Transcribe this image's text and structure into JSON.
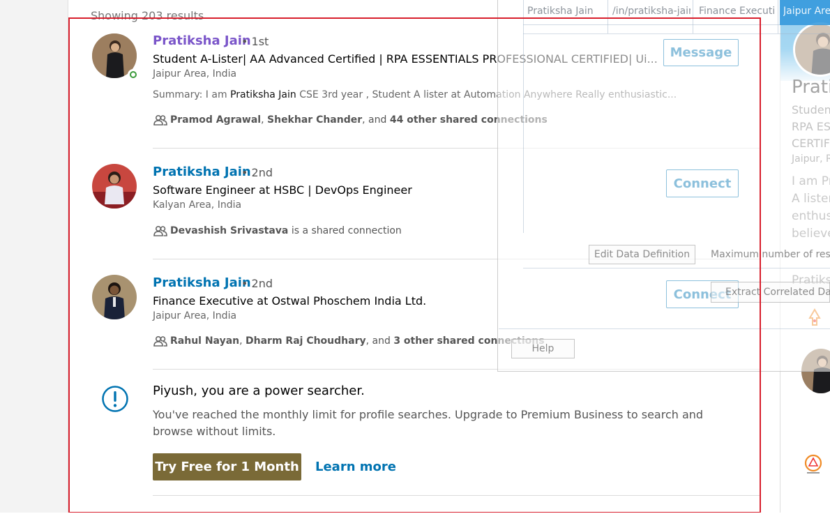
{
  "results_summary": "Showing 203 results",
  "results": [
    {
      "name": "Pratiksha Jain",
      "degree": "• 1st",
      "headline": "Student A-Lister| AA Advanced Certified | RPA ESSENTIALS PROFESSIONAL CERTIFIED| Ui...",
      "location": "Jaipur Area, India",
      "summary_prefix": "Summary: I am ",
      "summary_highlight": "Pratiksha Jain",
      "summary_suffix": " CSE 3rd year , Student A lister at Automation Anywhere Really enthusiastic...",
      "shared_a": "Pramod Agrawal",
      "shared_sep": ", ",
      "shared_b": "Shekhar Chander",
      "shared_and": ", and ",
      "shared_c": "44 other shared connections",
      "action": "Message"
    },
    {
      "name": "Pratiksha Jain",
      "degree": "• 2nd",
      "headline": "Software Engineer at HSBC | DevOps Engineer",
      "location": "Kalyan Area, India",
      "shared_a": "Devashish Srivastava",
      "shared_tail": " is a shared connection",
      "action": "Connect"
    },
    {
      "name": "Pratiksha Jain",
      "degree": "• 2nd",
      "headline": "Finance Executive at Ostwal Phoschem India Ltd.",
      "location": "Jaipur Area, India",
      "shared_a": "Rahul Nayan",
      "shared_sep": ", ",
      "shared_b": "Dharm Raj Choudhary",
      "shared_and": ", and ",
      "shared_c": "3 other shared connections",
      "action": "Connect"
    }
  ],
  "upsell": {
    "title": "Piyush, you are a power searcher.",
    "body": "You've reached the monthly limit for profile searches. Upgrade to Premium Business to search and browse without limits.",
    "try_label": "Try Free for 1 Month",
    "learn_label": "Learn more"
  },
  "right_rail": {
    "name": "Pratik",
    "headline_1": "Student",
    "headline_2": "RPA ESS",
    "headline_3": "CERTIFI",
    "location": "Jaipur, R",
    "desc_1": "I am Pra",
    "desc_2": "A lister",
    "desc_3": "enthusi",
    "desc_4": "believe",
    "bottom_name": "Pratiksh"
  },
  "overlay": {
    "cells": [
      "Pratiksha Jain",
      "/in/pratiksha-jain",
      "Finance Executiv",
      "Jaipur Area"
    ],
    "edit_button": "Edit Data Definition",
    "max_label": "Maximum number of results",
    "extract_button": "Extract Correlated Data",
    "help_button": "Help"
  },
  "colors": {
    "link_blue": "#0073b1",
    "visited_purple": "#7a55c9",
    "premium_gold": "#7a6a37",
    "highlight_red": "#d81e2c",
    "online_green": "#3a9a3a"
  }
}
